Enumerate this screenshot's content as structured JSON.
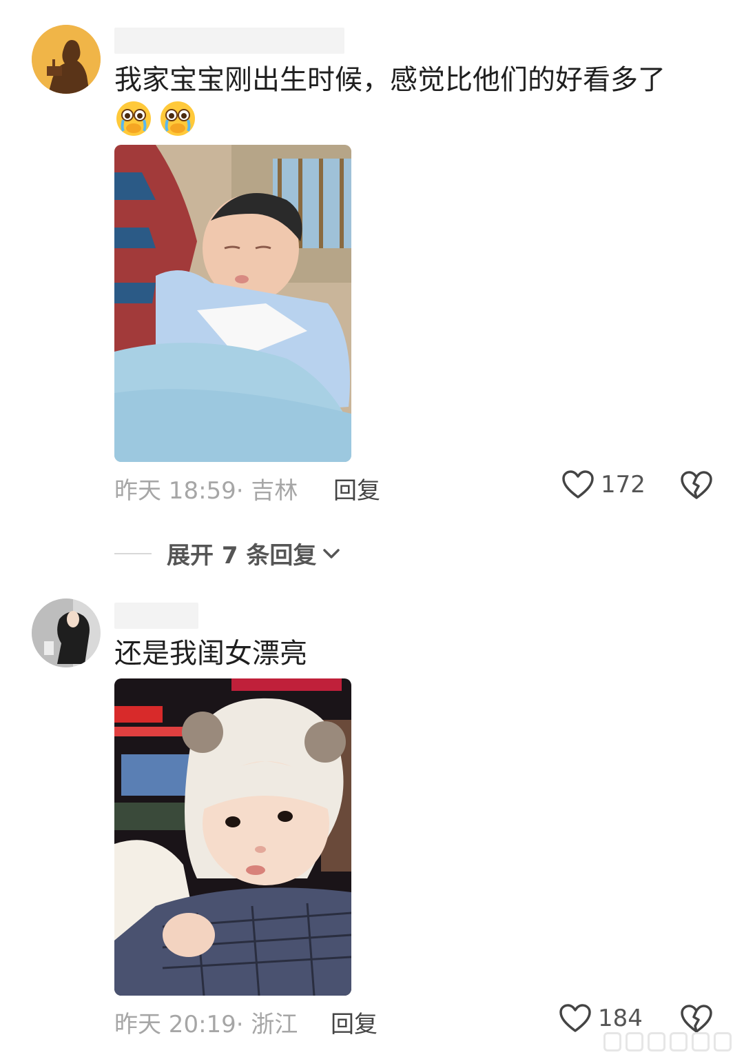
{
  "comments": [
    {
      "text": "我家宝宝刚出生时候，感觉比他们的好看多了",
      "emojis": [
        "crying-face-emoji",
        "crying-face-emoji"
      ],
      "time": "昨天 18:59",
      "location": "吉林",
      "reply_label": "回复",
      "likes": "172"
    },
    {
      "text": "还是我闺女漂亮",
      "time": "昨天 20:19",
      "location": "浙江",
      "reply_label": "回复",
      "likes": "184"
    }
  ],
  "expand_replies": {
    "label": "展开 7 条回复"
  },
  "colors": {
    "meta": "#a6a6a6",
    "background": "#ffffff",
    "text": "#1f1f1f"
  }
}
